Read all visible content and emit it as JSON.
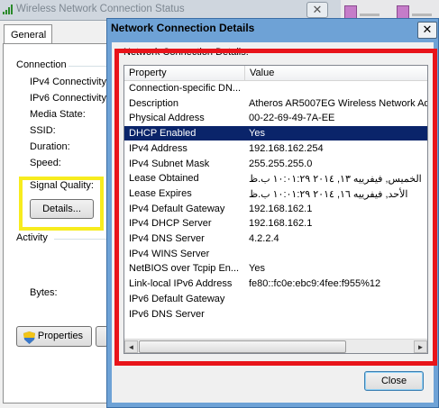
{
  "background_window": {
    "title": "Wireless Network Connection Status",
    "close_glyph": "✕",
    "tab_general": "General",
    "connection_group": "Connection",
    "labels": [
      "IPv4 Connectivity:",
      "IPv6 Connectivity:",
      "Media State:",
      "SSID:",
      "Duration:",
      "Speed:"
    ],
    "signal_quality": "Signal Quality:",
    "details_button": "Details...",
    "activity_group": "Activity",
    "bytes_label": "Bytes:",
    "properties_button": "Properties"
  },
  "dialog": {
    "title": "Network Connection Details",
    "close_glyph": "✕",
    "section_label": "Network Connection Details:",
    "columns": [
      "Property",
      "Value"
    ],
    "rows": [
      {
        "property": "Connection-specific DN...",
        "value": ""
      },
      {
        "property": "Description",
        "value": "Atheros AR5007EG Wireless Network Ad"
      },
      {
        "property": "Physical Address",
        "value": "00-22-69-49-7A-EE"
      },
      {
        "property": "DHCP Enabled",
        "value": "Yes"
      },
      {
        "property": "IPv4 Address",
        "value": "192.168.162.254"
      },
      {
        "property": "IPv4 Subnet Mask",
        "value": "255.255.255.0"
      },
      {
        "property": "Lease Obtained",
        "value": "الخميس, فيفرييه ١٣, ٢٠١٤ ١٠:٠١:٢٩ ب.ظ"
      },
      {
        "property": "Lease Expires",
        "value": "الأحد, فيفرييه ١٦, ٢٠١٤ ١٠:٠١:٢٩ ب.ظ"
      },
      {
        "property": "IPv4 Default Gateway",
        "value": "192.168.162.1"
      },
      {
        "property": "IPv4 DHCP Server",
        "value": "192.168.162.1"
      },
      {
        "property": "IPv4 DNS Server",
        "value": "4.2.2.4"
      },
      {
        "property": "IPv4 WINS Server",
        "value": ""
      },
      {
        "property": "NetBIOS over Tcpip En...",
        "value": "Yes"
      },
      {
        "property": "Link-local IPv6 Address",
        "value": "fe80::fc0e:ebc9:4fee:f955%12"
      },
      {
        "property": "IPv6 Default Gateway",
        "value": ""
      },
      {
        "property": "IPv6 DNS Server",
        "value": ""
      }
    ],
    "selected_row": 3,
    "scroll_left": "◄",
    "scroll_right": "►",
    "close_button": "Close"
  },
  "colors": {
    "selection": "#0a246a",
    "highlight_red": "#e8141a",
    "highlight_yellow": "#f7ec1e",
    "dialog_frame": "#6ea2d6"
  },
  "icons": [
    "signal-strength-icon",
    "close-icon",
    "shield-icon",
    "scroll-left-arrow-icon",
    "scroll-right-arrow-icon"
  ]
}
